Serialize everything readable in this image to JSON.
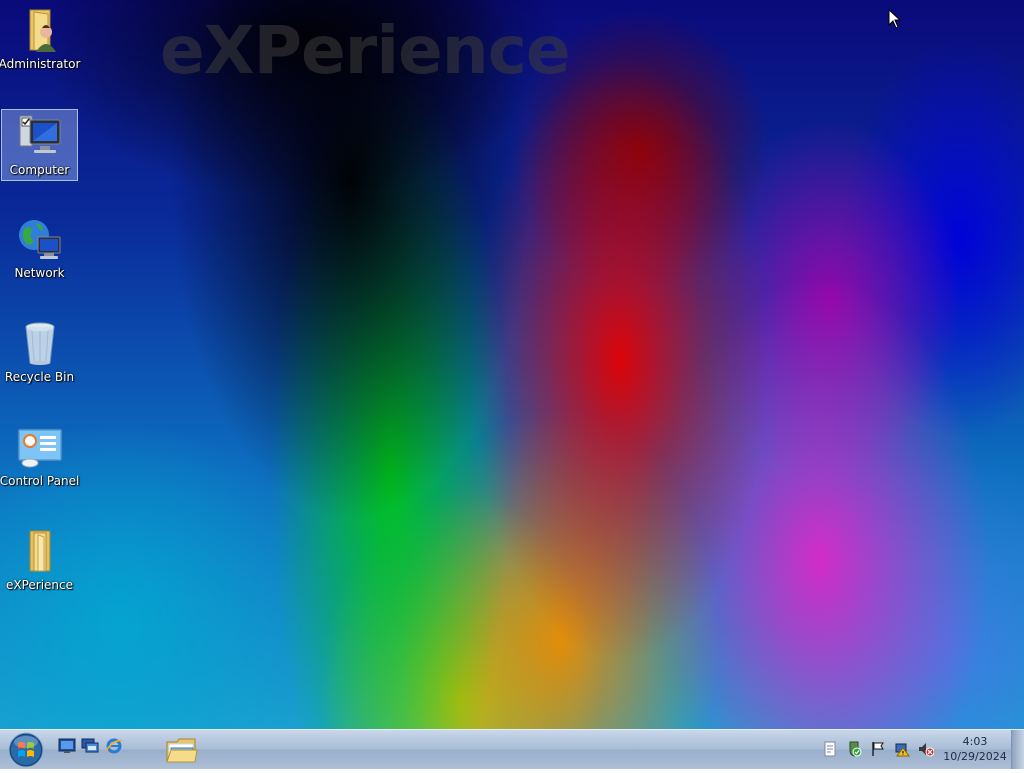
{
  "wallpaper": {
    "watermark_text": "eXPerience"
  },
  "desktop_icons": [
    {
      "label": "Administrator",
      "icon": "user-folder-icon"
    },
    {
      "label": "Computer",
      "icon": "computer-icon",
      "selected": true
    },
    {
      "label": "Network",
      "icon": "network-icon"
    },
    {
      "label": "Recycle Bin",
      "icon": "recycle-bin-icon"
    },
    {
      "label": "Control Panel",
      "icon": "control-panel-icon"
    },
    {
      "label": "eXPerience",
      "icon": "folder-icon"
    }
  ],
  "taskbar": {
    "start_icon": "windows-orb-icon",
    "quick_launch": [
      "show-desktop-icon",
      "switch-windows-icon",
      "internet-explorer-icon"
    ],
    "pinned": [
      "windows-explorer-icon"
    ],
    "tray_icons": [
      "notes-icon",
      "security-icon",
      "action-center-flag-icon",
      "network-tray-icon",
      "volume-muted-icon"
    ],
    "clock": {
      "time": "4:03",
      "date": "10/29/2024"
    }
  }
}
